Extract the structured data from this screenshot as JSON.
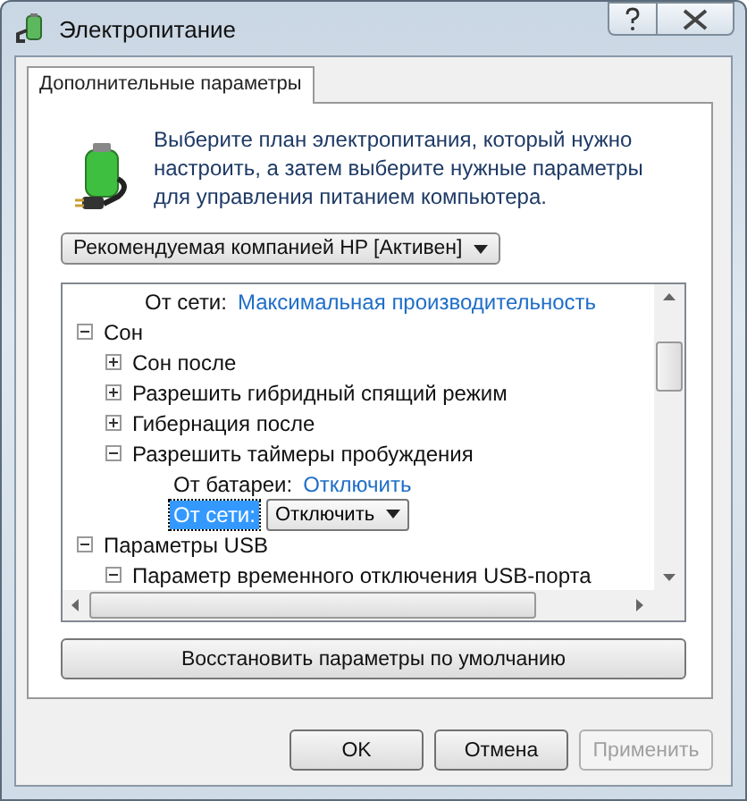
{
  "window": {
    "title": "Электропитание"
  },
  "tabs": [
    {
      "label": "Дополнительные параметры",
      "selected": true
    }
  ],
  "description": "Выберите план электропитания, который нужно настроить, а затем выберите нужные параметры для управления питанием компьютера.",
  "plan_dropdown": {
    "value": "Рекомендуемая компанией HP [Активен]"
  },
  "tree": {
    "continued": [
      {
        "kind": "value",
        "label": "От сети:",
        "value": "Максимальная производительность",
        "selected": false
      }
    ],
    "items": [
      {
        "kind": "group",
        "label": "Сон",
        "expanded": true,
        "children": [
          {
            "kind": "group",
            "label": "Сон после",
            "expanded": false
          },
          {
            "kind": "group",
            "label": "Разрешить гибридный спящий режим",
            "expanded": false
          },
          {
            "kind": "group",
            "label": "Гибернация после",
            "expanded": false
          },
          {
            "kind": "group",
            "label": "Разрешить таймеры пробуждения",
            "expanded": true,
            "children": [
              {
                "kind": "value",
                "label": "От батареи:",
                "value": "Отключить",
                "selected": false
              },
              {
                "kind": "value",
                "label": "От сети:",
                "value": "Отключить",
                "selected": true
              }
            ]
          }
        ]
      },
      {
        "kind": "group",
        "label": "Параметры USB",
        "expanded": true,
        "children": [
          {
            "kind": "group",
            "label": "Параметр временного отключения USB-порта",
            "expanded": true
          }
        ]
      }
    ]
  },
  "restore_button": "Восстановить параметры по умолчанию",
  "buttons": [
    {
      "label": "OK",
      "disabled": false
    },
    {
      "label": "Отмена",
      "disabled": false
    },
    {
      "label": "Применить",
      "disabled": true
    }
  ]
}
